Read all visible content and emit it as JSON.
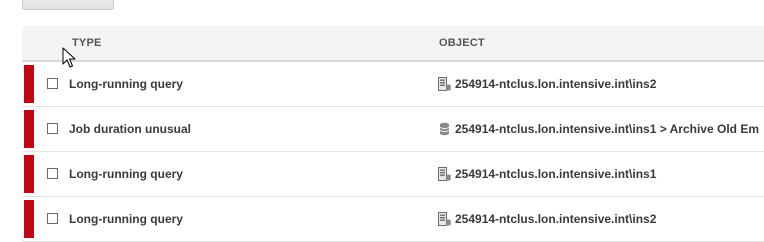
{
  "table": {
    "columns": {
      "type": "TYPE",
      "object": "OBJECT"
    },
    "rows": [
      {
        "type": "Long-running query",
        "object": "254914-ntclus.lon.intensive.int\\ins2",
        "object_icon": "sql-instance-icon",
        "severity_color": "#c00612",
        "checked": false
      },
      {
        "type": "Job duration unusual",
        "object": "254914-ntclus.lon.intensive.int\\ins1 > Archive Old Em",
        "object_icon": "database-icon",
        "severity_color": "#c00612",
        "checked": false
      },
      {
        "type": "Long-running query",
        "object": "254914-ntclus.lon.intensive.int\\ins1",
        "object_icon": "sql-instance-icon",
        "severity_color": "#c00612",
        "checked": false
      },
      {
        "type": "Long-running query",
        "object": "254914-ntclus.lon.intensive.int\\ins2",
        "object_icon": "sql-instance-icon",
        "severity_color": "#c00612",
        "checked": false
      }
    ]
  }
}
